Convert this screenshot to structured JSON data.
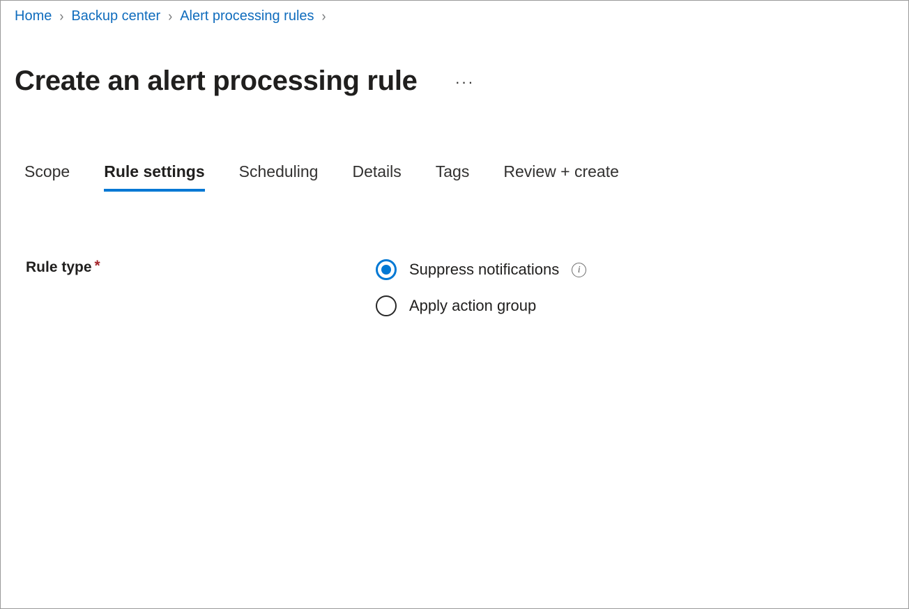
{
  "breadcrumb": {
    "separator": "›",
    "items": [
      {
        "label": "Home"
      },
      {
        "label": "Backup center"
      },
      {
        "label": "Alert processing rules"
      }
    ]
  },
  "header": {
    "title": "Create an alert processing rule",
    "more_actions": "···"
  },
  "tabs": [
    {
      "label": "Scope",
      "active": false
    },
    {
      "label": "Rule settings",
      "active": true
    },
    {
      "label": "Scheduling",
      "active": false
    },
    {
      "label": "Details",
      "active": false
    },
    {
      "label": "Tags",
      "active": false
    },
    {
      "label": "Review + create",
      "active": false
    }
  ],
  "form": {
    "rule_type": {
      "label": "Rule type",
      "required_marker": "*",
      "selected": "Suppress notifications",
      "options": [
        {
          "label": "Suppress notifications",
          "checked": true,
          "has_info": true,
          "info_glyph": "i"
        },
        {
          "label": "Apply action group",
          "checked": false,
          "has_info": false
        }
      ]
    }
  },
  "colors": {
    "accent": "#0078d4",
    "link": "#0f6cbd",
    "required": "#a4262c",
    "text": "#201f1e",
    "border": "#9a9a9a"
  }
}
